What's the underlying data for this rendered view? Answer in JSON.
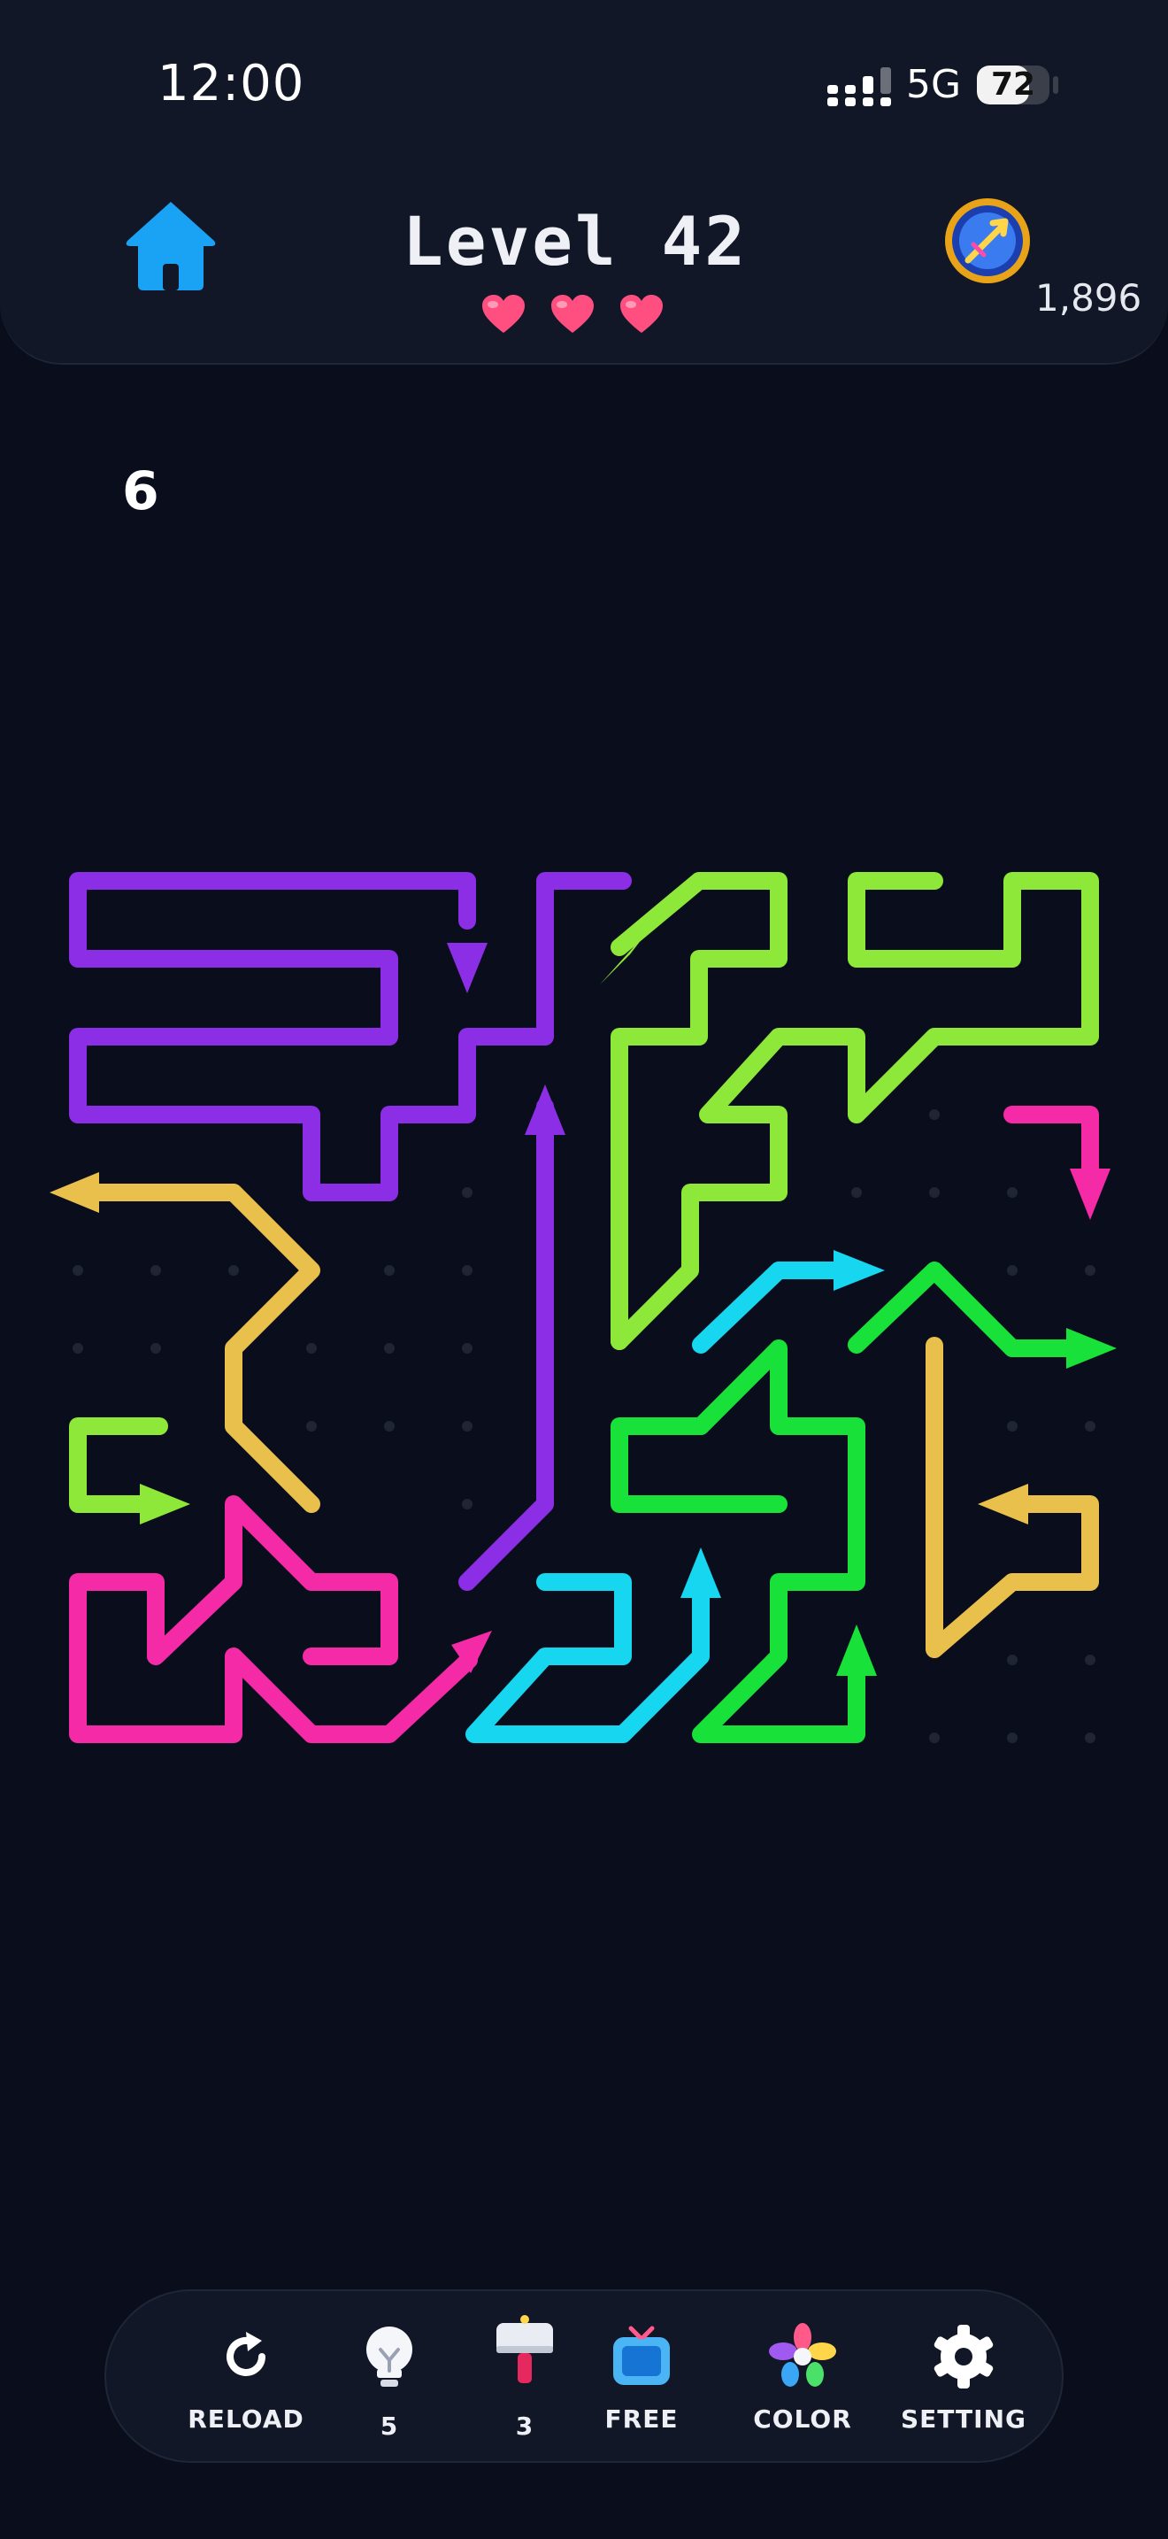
{
  "status_bar": {
    "time": "12:00",
    "network": "5G",
    "battery": "72",
    "battery_level": 72
  },
  "header": {
    "level_title": "Level 42",
    "lives": 3,
    "coins": "1,896"
  },
  "moves": "6",
  "colors": {
    "purple": "#8b2ee6",
    "lime": "#8ee83a",
    "yellow": "#e9c04c",
    "pink": "#f52aa6",
    "cyan": "#16d6f0",
    "green": "#18e23a",
    "home": "#1aa3f5",
    "heart": "#ff4f80"
  },
  "toolbar": {
    "reload_label": "RELOAD",
    "hint_count": "5",
    "hammer_count": "3",
    "free_label": "FREE",
    "color_label": "COLOR",
    "setting_label": "SETTING"
  },
  "icons": {
    "home": "home-icon",
    "coin": "coin-icon",
    "reload": "reload-icon",
    "hint": "lightbulb-icon",
    "hammer": "hammer-icon",
    "free": "tv-icon",
    "color": "flower-icon",
    "setting": "gear-icon"
  }
}
